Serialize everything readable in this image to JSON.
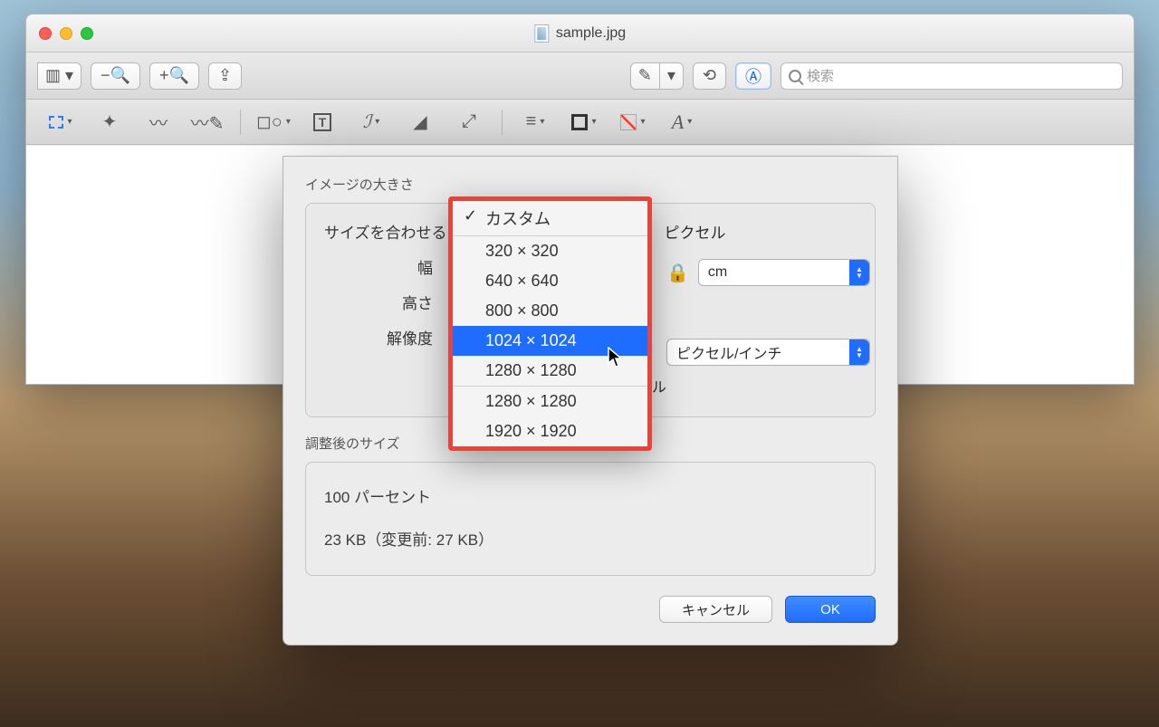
{
  "window": {
    "title": "sample.jpg",
    "search_placeholder": "検索"
  },
  "dialog": {
    "title": "イメージの大きさ",
    "fit_label": "サイズを合わせる",
    "fit_value_suffix": "ピクセル",
    "width_label": "幅",
    "height_label": "高さ",
    "resolution_label": "解像度",
    "unit_value": "cm",
    "res_unit_value": "ピクセル/インチ",
    "resample_suffix": "ル",
    "result_title": "調整後のサイズ",
    "result_percent": "100 パーセント",
    "result_size": "23 KB（変更前: 27 KB）",
    "cancel": "キャンセル",
    "ok": "OK"
  },
  "dropdown": {
    "groups": [
      {
        "items": [
          {
            "label": "カスタム",
            "checked": true,
            "highlight": false
          }
        ]
      },
      {
        "items": [
          {
            "label": "320 × 320",
            "checked": false,
            "highlight": false
          },
          {
            "label": "640 × 640",
            "checked": false,
            "highlight": false
          },
          {
            "label": "800 × 800",
            "checked": false,
            "highlight": false
          },
          {
            "label": "1024 × 1024",
            "checked": false,
            "highlight": true
          },
          {
            "label": "1280 × 1280",
            "checked": false,
            "highlight": false
          }
        ]
      },
      {
        "items": [
          {
            "label": "1280 × 1280",
            "checked": false,
            "highlight": false
          },
          {
            "label": "1920 × 1920",
            "checked": false,
            "highlight": false
          }
        ]
      }
    ]
  }
}
